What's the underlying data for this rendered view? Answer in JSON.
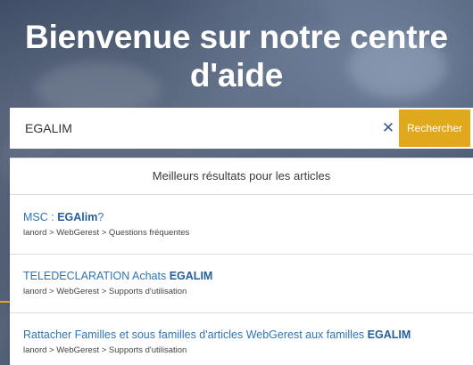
{
  "hero": {
    "title_line1": "Bienvenue sur notre centre",
    "title_line2": "d'aide"
  },
  "search": {
    "value": "EGALIM",
    "clear_icon": "close-icon",
    "button_label": "Rechercher"
  },
  "results": {
    "header": "Meilleurs résultats pour les articles",
    "items": [
      {
        "title_before": "MSC : ",
        "title_match": "EGAlim",
        "title_after": "?",
        "path": "lanord > WebGerest > Questions fréquentes"
      },
      {
        "title_before": "TELEDECLARATION Achats ",
        "title_match": "EGALIM",
        "title_after": "",
        "path": "lanord > WebGerest > Supports d'utilisation"
      },
      {
        "title_before": "Rattacher Familles et sous familles d'articles WebGerest aux familles ",
        "title_match": "EGALIM",
        "title_after": "",
        "path": "lanord > WebGerest > Supports d'utilisation"
      }
    ]
  },
  "colors": {
    "accent": "#e0a81c",
    "link": "#2f74b5",
    "hero_overlay": "#3f4e66"
  }
}
